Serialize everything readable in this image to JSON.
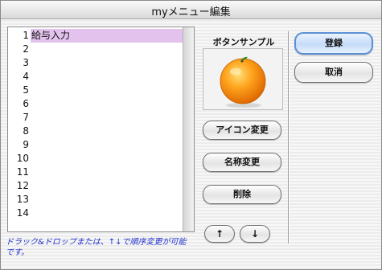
{
  "window": {
    "title": "myメニュー編集"
  },
  "list": {
    "rows": [
      {
        "num": "1",
        "label": "給与入力",
        "selected": true
      },
      {
        "num": "2",
        "label": ""
      },
      {
        "num": "3",
        "label": ""
      },
      {
        "num": "4",
        "label": ""
      },
      {
        "num": "5",
        "label": ""
      },
      {
        "num": "6",
        "label": ""
      },
      {
        "num": "7",
        "label": ""
      },
      {
        "num": "8",
        "label": ""
      },
      {
        "num": "9",
        "label": ""
      },
      {
        "num": "10",
        "label": ""
      },
      {
        "num": "11",
        "label": ""
      },
      {
        "num": "12",
        "label": ""
      },
      {
        "num": "13",
        "label": ""
      },
      {
        "num": "14",
        "label": ""
      }
    ]
  },
  "sample": {
    "title": "ボタンサンプル",
    "icon": "orange-icon"
  },
  "buttons": {
    "change_icon": "アイコン変更",
    "rename": "名称変更",
    "delete": "削除",
    "up": "↑",
    "down": "↓",
    "register": "登録",
    "cancel": "取消"
  },
  "hint": "ドラック&ドロップまたは、↑↓で順序変更が可能です。",
  "colors": {
    "selection": "#e3c3ee",
    "hint_text": "#2233cc",
    "default_button": "#5b8fd6"
  }
}
